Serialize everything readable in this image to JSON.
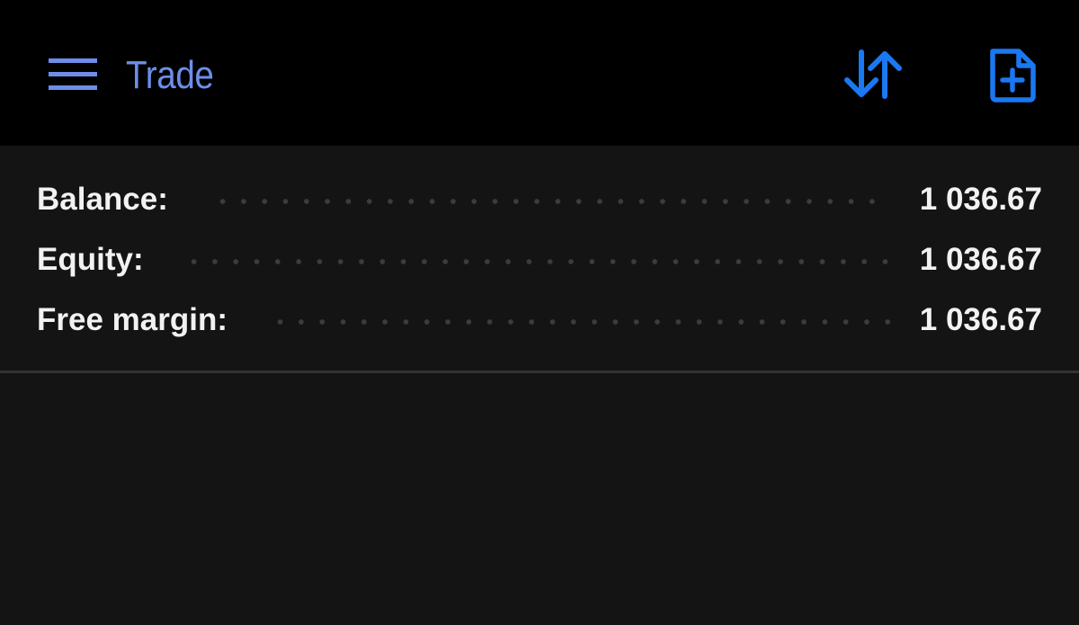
{
  "app_bar": {
    "title": "Trade",
    "menu_icon": "hamburger-menu-icon",
    "sort_icon": "sort-arrows-icon",
    "new_order_icon": "file-plus-icon"
  },
  "colors": {
    "app_bar_background": "#000000",
    "content_background": "#141414",
    "title_color": "#6d8ee8",
    "accent_blue": "#1a78f2",
    "text_primary": "#f2f2f2",
    "dot_leader": "#3c3c3c",
    "divider": "#333333"
  },
  "summary": {
    "rows": [
      {
        "label": "Balance:",
        "value": "1 036.67"
      },
      {
        "label": "Equity:",
        "value": "1 036.67"
      },
      {
        "label": "Free margin:",
        "value": "1 036.67"
      }
    ]
  }
}
